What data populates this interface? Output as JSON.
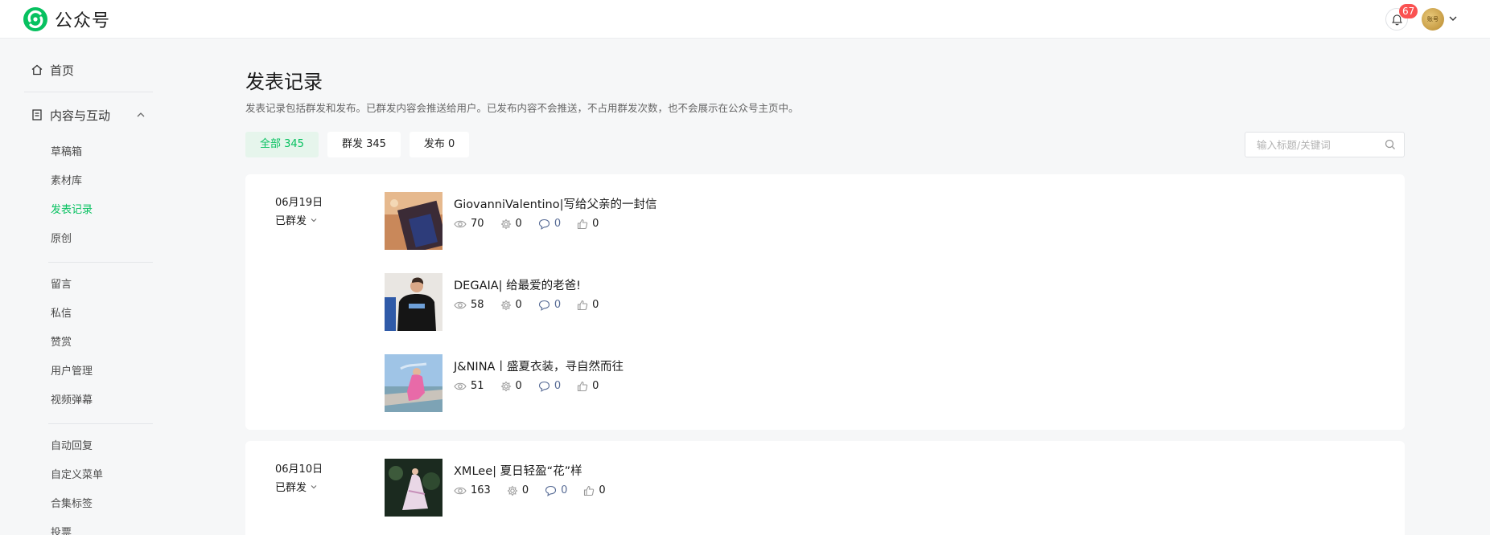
{
  "header": {
    "app_name": "公众号",
    "notification_count": "67",
    "avatar_text": "账号",
    "colors": {
      "brand": "#07c160",
      "badge": "#fa5151"
    }
  },
  "sidebar": {
    "home": "首页",
    "content_group": "内容与互动",
    "content_items": [
      "草稿箱",
      "素材库",
      "发表记录",
      "原创"
    ],
    "interact_items": [
      "留言",
      "私信",
      "赞赏",
      "用户管理",
      "视频弹幕"
    ],
    "tool_items": [
      "自动回复",
      "自定义菜单",
      "合集标签",
      "投票"
    ],
    "active_item": "发表记录"
  },
  "main": {
    "title": "发表记录",
    "description": "发表记录包括群发和发布。已群发内容会推送给用户。已发布内容不会推送，不占用群发次数，也不会展示在公众号主页中。",
    "tabs": [
      {
        "label": "全部 345",
        "active": true
      },
      {
        "label": "群发 345",
        "active": false
      },
      {
        "label": "发布 0",
        "active": false
      }
    ],
    "search_placeholder": "输入标题/关键词"
  },
  "records": [
    {
      "date": "06月19日",
      "status": "已群发",
      "articles": [
        {
          "title": "GiovanniValentino|写给父亲的一封信",
          "views": "70",
          "shares": "0",
          "comments": "0",
          "likes": "0"
        },
        {
          "title": "DEGAIA| 给最爱的老爸!",
          "views": "58",
          "shares": "0",
          "comments": "0",
          "likes": "0"
        },
        {
          "title": "J&NINA丨盛夏衣装，寻自然而往",
          "views": "51",
          "shares": "0",
          "comments": "0",
          "likes": "0"
        }
      ]
    },
    {
      "date": "06月10日",
      "status": "已群发",
      "articles": [
        {
          "title": "XMLee| 夏日轻盈“花”样",
          "views": "163",
          "shares": "0",
          "comments": "0",
          "likes": "0"
        }
      ]
    }
  ]
}
